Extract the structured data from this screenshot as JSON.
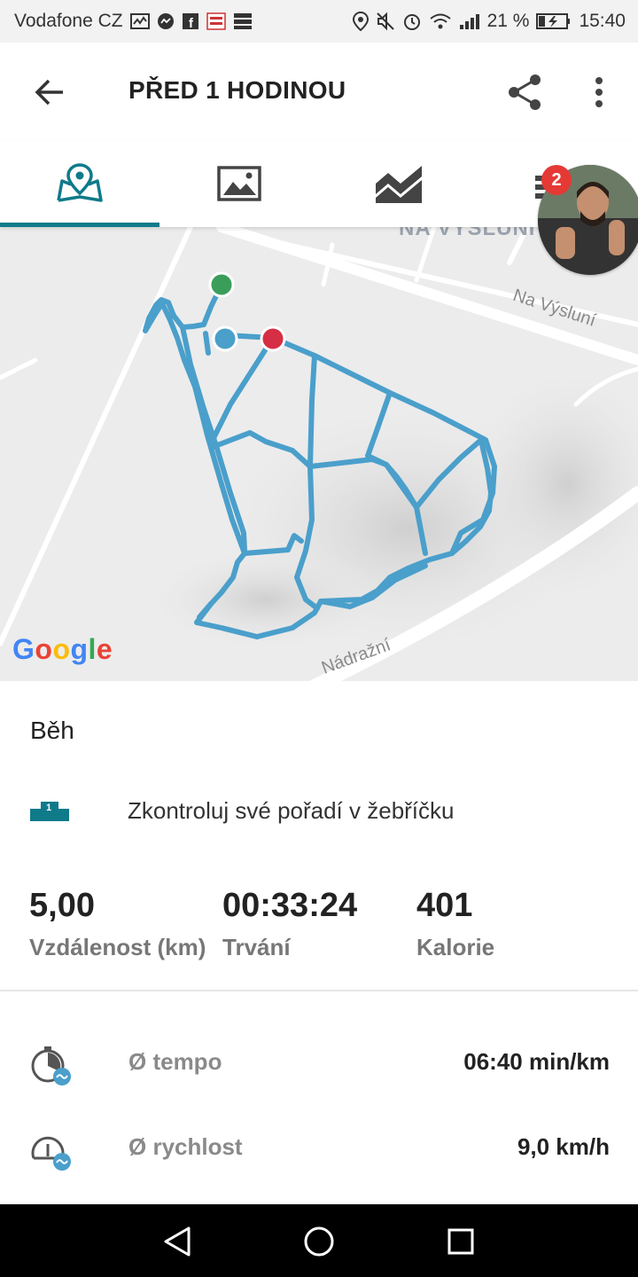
{
  "status_bar": {
    "carrier": "Vodafone CZ",
    "battery_percent": "21 %",
    "time": "15:40"
  },
  "header": {
    "title": "PŘED 1 HODINOU"
  },
  "tabs": [
    {
      "name": "map",
      "icon": "map-pin-icon"
    },
    {
      "name": "photos",
      "icon": "image-icon"
    },
    {
      "name": "charts",
      "icon": "chart-area-icon"
    },
    {
      "name": "list",
      "icon": "list-icon"
    }
  ],
  "badge": {
    "count": "2"
  },
  "map": {
    "street_top": "NA VÝSLUNÍ",
    "street_right": "Na Výsluní",
    "street_bottom": "Nádražní",
    "provider": "Google",
    "route_color": "#4a9fcb"
  },
  "activity": {
    "type": "Běh",
    "leaderboard_text": "Zkontroluj své pořadí v žebříčku"
  },
  "stats": [
    {
      "value": "5,00",
      "label": "Vzdálenost (km)"
    },
    {
      "value": "00:33:24",
      "label": "Trvání"
    },
    {
      "value": "401",
      "label": "Kalorie"
    }
  ],
  "metrics": [
    {
      "label": "Ø tempo",
      "value": "06:40 min/km",
      "icon": "stopwatch-icon"
    },
    {
      "label": "Ø rychlost",
      "value": "9,0 km/h",
      "icon": "speedometer-icon"
    }
  ],
  "colors": {
    "accent": "#0f7a8a",
    "start": "#3a9e5a",
    "end": "#d62e44",
    "badge": "#e53935"
  }
}
